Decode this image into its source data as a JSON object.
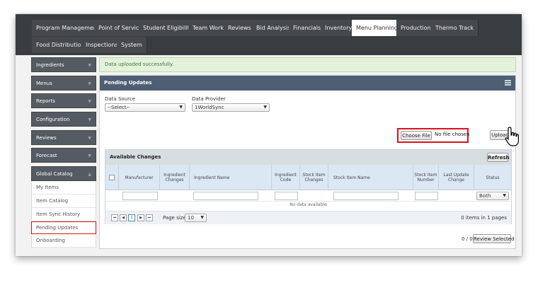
{
  "nav": {
    "tabs_row1": [
      "Program Management",
      "Point of Service",
      "Student Eligibility",
      "Team Work",
      "Reviews",
      "Bid Analysis",
      "Financials",
      "Inventory",
      "Menu Planning",
      "Production",
      "Thermo Track"
    ],
    "tabs_row2": [
      "Food Distribution",
      "Inspections",
      "System"
    ],
    "active": "Menu Planning"
  },
  "sidebar": {
    "sections": [
      "Ingredients",
      "Menus",
      "Reports",
      "Configuration",
      "Reviews",
      "Forecast",
      "Global Catalog"
    ],
    "subitems": [
      "My Items",
      "Item Catalog",
      "Item Sync History",
      "Pending Updates",
      "Onboarding"
    ],
    "highlighted": "Pending Updates"
  },
  "alert": {
    "message": "Data uploaded successfully."
  },
  "panel": {
    "title": "Pending Updates",
    "data_source_label": "Data Source",
    "data_source_value": "--Select--",
    "data_provider_label": "Data Provider",
    "data_provider_value": "1WorldSync",
    "choose_file_label": "Choose File",
    "file_status": "No file chosen",
    "upload_label": "Upload"
  },
  "grid": {
    "title": "Available Changes",
    "refresh_label": "Refresh",
    "columns": [
      "Manufacturer",
      "Ingredient Changes",
      "Ingredient Name",
      "Ingredient Code",
      "Stock Item Changes",
      "Stock Item Name",
      "Stock Item Number",
      "Last Update Change",
      "Status"
    ],
    "status_filter": "Both",
    "empty_text": "No data available",
    "pager": {
      "first": "⏮",
      "prev": "◀",
      "current": "1",
      "next": "▶",
      "last": "⏭",
      "page_size_label": "Page size:",
      "page_size": "10",
      "summary": "0 items in 1 pages"
    }
  },
  "footer": {
    "count": "0 / 0",
    "review_label": "Review Selected"
  },
  "colors": {
    "nav_bg": "#3a3d40",
    "panel_header": "#4e5f73",
    "highlight": "#d8121b",
    "alert_bg": "#e4f2dc"
  }
}
